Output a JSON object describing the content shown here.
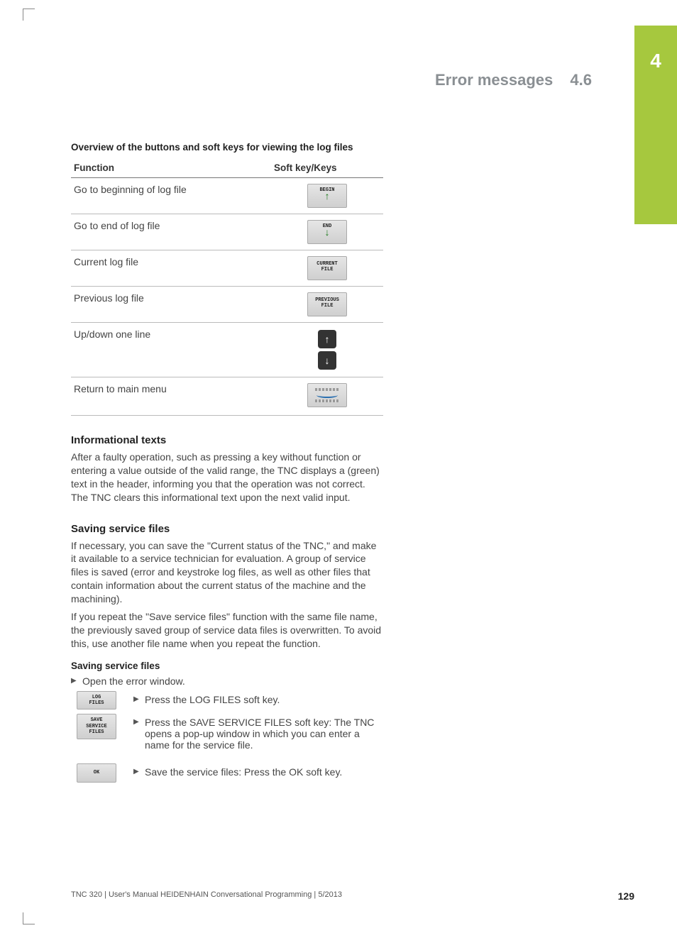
{
  "chapter_tab": "4",
  "header": {
    "title": "Error messages",
    "section_number": "4.6"
  },
  "table": {
    "title": "Overview of the buttons and soft keys for viewing the log files",
    "head": {
      "func": "Function",
      "key": "Soft key/Keys"
    },
    "rows": [
      {
        "func": "Go to beginning of log file",
        "key_type": "softkey-begin",
        "key_label": "BEGIN"
      },
      {
        "func": "Go to end of log file",
        "key_type": "softkey-end",
        "key_label": "END"
      },
      {
        "func": "Current log file",
        "key_type": "softkey-2line",
        "key_line1": "CURRENT",
        "key_line2": "FILE"
      },
      {
        "func": "Previous log file",
        "key_type": "softkey-2line",
        "key_line1": "PREVIOUS",
        "key_line2": "FILE"
      },
      {
        "func": "Up/down one line",
        "key_type": "hardkeys-updown"
      },
      {
        "func": "Return to main menu",
        "key_type": "softkey-menu"
      }
    ]
  },
  "info_section": {
    "heading": "Informational texts",
    "paragraph": "After a faulty operation, such as pressing a key without function or entering a value outside of the valid range, the TNC displays a (green) text in the header, informing you that the operation was not correct. The TNC clears this informational text upon the next valid input."
  },
  "save_section": {
    "heading": "Saving service files",
    "para1": "If necessary, you can save the \"Current status of the TNC,\" and make it available to a service technician for evaluation. A group of service files is saved (error and keystroke log files, as well as other files that contain information about the current status of the machine and the machining).",
    "para2": "If you repeat the \"Save service files\" function with the same file name, the previously saved group of service data files is overwritten. To avoid this, use another file name when you repeat the function.",
    "subheading": "Saving service files",
    "step_open": "Open the error window.",
    "steps": [
      {
        "key_label": "LOG\nFILES",
        "text": "Press the LOG FILES soft key."
      },
      {
        "key_label": "SAVE\nSERVICE\nFILES",
        "text": "Press the SAVE SERVICE FILES soft key: The TNC opens a pop-up window in which you can enter a name for the service file."
      },
      {
        "key_label": "OK",
        "text": "Save the service files: Press the OK soft key."
      }
    ]
  },
  "footer": {
    "text": "TNC 320 | User's Manual HEIDENHAIN Conversational Programming | 5/2013",
    "page": "129"
  }
}
